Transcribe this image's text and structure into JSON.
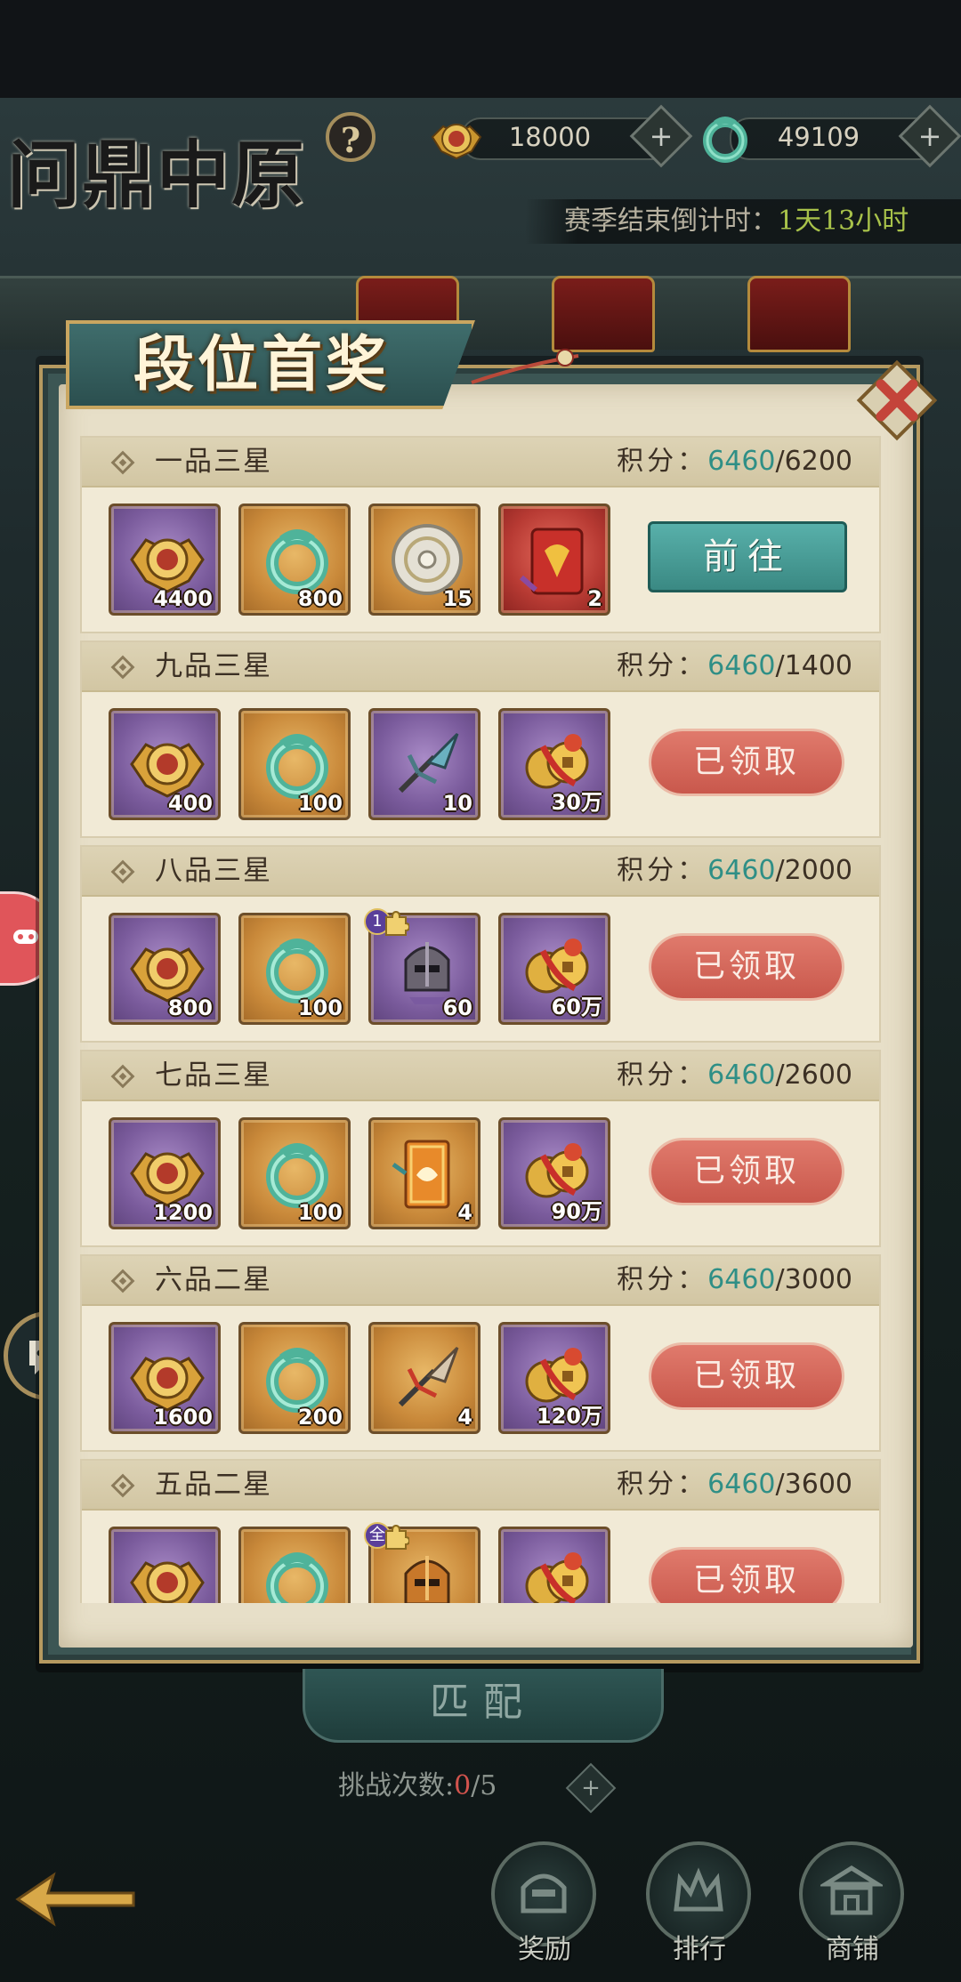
{
  "header": {
    "title": "问鼎中原",
    "help_symbol": "?",
    "currency": [
      {
        "icon": "gold-medal-icon",
        "value": "18000",
        "plus": "+"
      },
      {
        "icon": "jade-dragon-icon",
        "value": "49109",
        "plus": "+"
      }
    ],
    "countdown_label": "赛季结束倒计时：",
    "countdown_value": "1天13小时"
  },
  "modal": {
    "title": "段位首奖",
    "score_label": "积分：",
    "go_label": "前往",
    "claimed_label": "已领取",
    "tiers": [
      {
        "name": "一品三星",
        "current": "6460",
        "target": "/6200",
        "status": "go",
        "rewards": [
          {
            "icon": "gold-medal-icon",
            "qty": "4400",
            "bg": "purple"
          },
          {
            "icon": "jade-dragon-icon",
            "qty": "800",
            "bg": "orange"
          },
          {
            "icon": "silver-disc-icon",
            "qty": "15",
            "bg": "orange"
          },
          {
            "icon": "red-envelope-icon",
            "qty": "2",
            "bg": "red"
          }
        ]
      },
      {
        "name": "九品三星",
        "current": "6460",
        "target": "/1400",
        "status": "claimed",
        "rewards": [
          {
            "icon": "gold-medal-icon",
            "qty": "400",
            "bg": "purple"
          },
          {
            "icon": "jade-dragon-icon",
            "qty": "100",
            "bg": "orange"
          },
          {
            "icon": "spear-head-icon",
            "qty": "10",
            "bg": "purple"
          },
          {
            "icon": "copper-coins-icon",
            "qty": "30万",
            "bg": "purple"
          }
        ]
      },
      {
        "name": "八品三星",
        "current": "6460",
        "target": "/2000",
        "status": "claimed",
        "rewards": [
          {
            "icon": "gold-medal-icon",
            "qty": "800",
            "bg": "purple"
          },
          {
            "icon": "jade-dragon-icon",
            "qty": "100",
            "bg": "orange"
          },
          {
            "icon": "helmet-icon",
            "qty": "60",
            "bg": "purple",
            "badge": "1"
          },
          {
            "icon": "copper-coins-icon",
            "qty": "60万",
            "bg": "purple"
          }
        ]
      },
      {
        "name": "七品三星",
        "current": "6460",
        "target": "/2600",
        "status": "claimed",
        "rewards": [
          {
            "icon": "gold-medal-icon",
            "qty": "1200",
            "bg": "purple"
          },
          {
            "icon": "jade-dragon-icon",
            "qty": "100",
            "bg": "orange"
          },
          {
            "icon": "orange-token-icon",
            "qty": "4",
            "bg": "orange"
          },
          {
            "icon": "copper-coins-icon",
            "qty": "90万",
            "bg": "purple"
          }
        ]
      },
      {
        "name": "六品二星",
        "current": "6460",
        "target": "/3000",
        "status": "claimed",
        "rewards": [
          {
            "icon": "gold-medal-icon",
            "qty": "1600",
            "bg": "purple"
          },
          {
            "icon": "jade-dragon-icon",
            "qty": "200",
            "bg": "orange"
          },
          {
            "icon": "spear-head-icon",
            "qty": "4",
            "bg": "orange"
          },
          {
            "icon": "copper-coins-icon",
            "qty": "120万",
            "bg": "purple"
          }
        ]
      },
      {
        "name": "五品二星",
        "current": "6460",
        "target": "/3600",
        "status": "claimed",
        "rewards": [
          {
            "icon": "gold-medal-icon",
            "qty": "",
            "bg": "purple"
          },
          {
            "icon": "jade-dragon-icon",
            "qty": "",
            "bg": "orange"
          },
          {
            "icon": "helmet-icon",
            "qty": "",
            "bg": "orange",
            "badge": "全"
          },
          {
            "icon": "copper-coins-icon",
            "qty": "",
            "bg": "purple"
          }
        ]
      }
    ]
  },
  "bottom": {
    "match_label": "匹配",
    "challenge_label": "挑战次数:",
    "challenge_count": "0",
    "challenge_total": "/5",
    "challenge_plus": "+",
    "nav": [
      {
        "label": "奖励",
        "icon": "reward-helmet-icon"
      },
      {
        "label": "排行",
        "icon": "ranking-crown-icon"
      },
      {
        "label": "商铺",
        "icon": "shop-pavilion-icon"
      }
    ]
  },
  "colors": {
    "accent_teal": "#2f8f86",
    "claimed_red": "#c9584c",
    "countdown_green": "#a8c24a"
  }
}
